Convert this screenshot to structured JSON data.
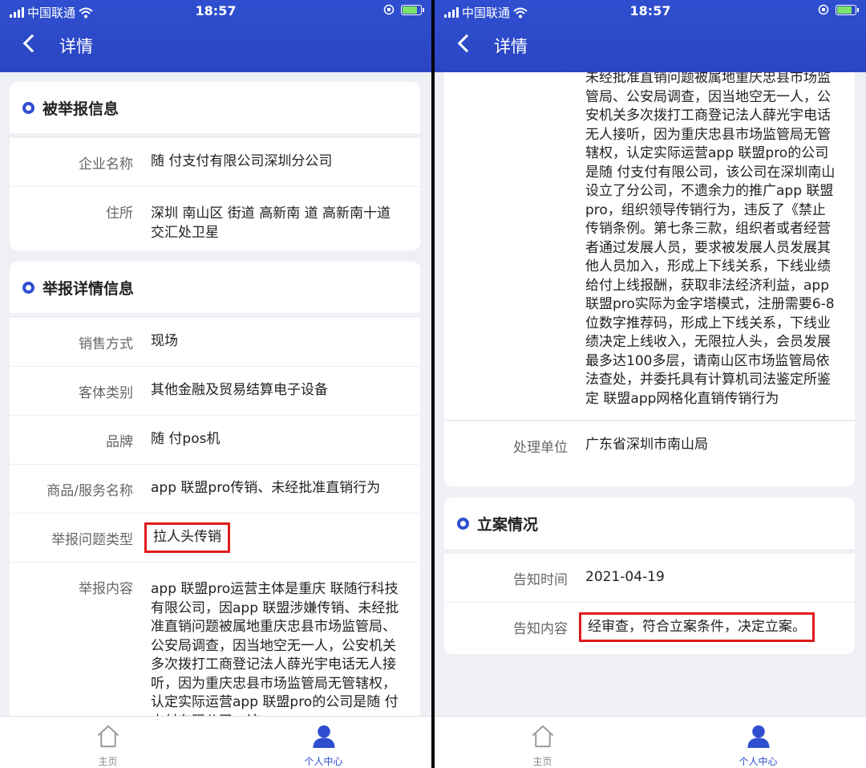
{
  "status_bar": {
    "carrier": "中国联通",
    "time": "18:57"
  },
  "nav": {
    "title": "详情"
  },
  "left": {
    "reported_info": {
      "title": "被举报信息",
      "rows": [
        {
          "label": "企业名称",
          "value": "随 付支付有限公司深圳分公司"
        },
        {
          "label": "住所",
          "value": "深圳 南山区 街道 高新南 道 高新南十道交汇处卫星"
        }
      ]
    },
    "detail_info": {
      "title": "举报详情信息",
      "rows": [
        {
          "label": "销售方式",
          "value": "现场"
        },
        {
          "label": "客体类别",
          "value": "其他金融及贸易结算电子设备"
        },
        {
          "label": "品牌",
          "value": "随 付pos机"
        },
        {
          "label": "商品/服务名称",
          "value": "app 联盟pro传销、未经批准直销行为"
        },
        {
          "label": "举报问题类型",
          "value": "拉人头传销"
        },
        {
          "label": "举报内容",
          "value": "app 联盟pro运营主体是重庆 联随行科技有限公司，因app 联盟涉嫌传销、未经批准直销问题被属地重庆忠县市场监管局、公安局调查，因当地空无一人，公安机关多次拨打工商登记法人薛光宇电话无人接听，因为重庆忠县市场监管局无管辖权，认定实际运营app 联盟pro的公司是随 付支付有限公司，该"
        }
      ]
    }
  },
  "right": {
    "content_tail": "未经批准直销问题被属地重庆忠县市场监管局、公安局调查，因当地空无一人，公安机关多次拨打工商登记法人薛光宇电话无人接听，因为重庆忠县市场监管局无管辖权，认定实际运营app 联盟pro的公司是随 付支付有限公司，该公司在深圳南山设立了分公司，不遗余力的推广app 联盟pro，组织领导传销行为，违反了《禁止传销条例。第七条三款，组织者或者经营者通过发展人员，要求被发展人员发展其他人员加入，形成上下线关系，下线业绩给付上线报酬，获取非法经济利益，app 联盟pro实际为金字塔模式，注册需要6-8位数字推荐码，形成上下线关系，下线业绩决定上线收入，无限拉人头，会员发展最多达100多层，请南山区市场监管局依法查处，并委托具有计算机司法鉴定所鉴定 联盟app网格化直销传销行为",
    "handling_unit": {
      "label": "处理单位",
      "value": "广东省深圳市南山局"
    },
    "case_info": {
      "title": "立案情况",
      "rows": [
        {
          "label": "告知时间",
          "value": "2021-04-19"
        },
        {
          "label": "告知内容",
          "value": "经审查，符合立案条件，决定立案。"
        }
      ]
    }
  },
  "tabbar": {
    "home": "主页",
    "personal": "个人中心"
  },
  "colors": {
    "primary": "#2f4fd0",
    "highlight": "#e01b1b",
    "background": "#eef0f5"
  }
}
